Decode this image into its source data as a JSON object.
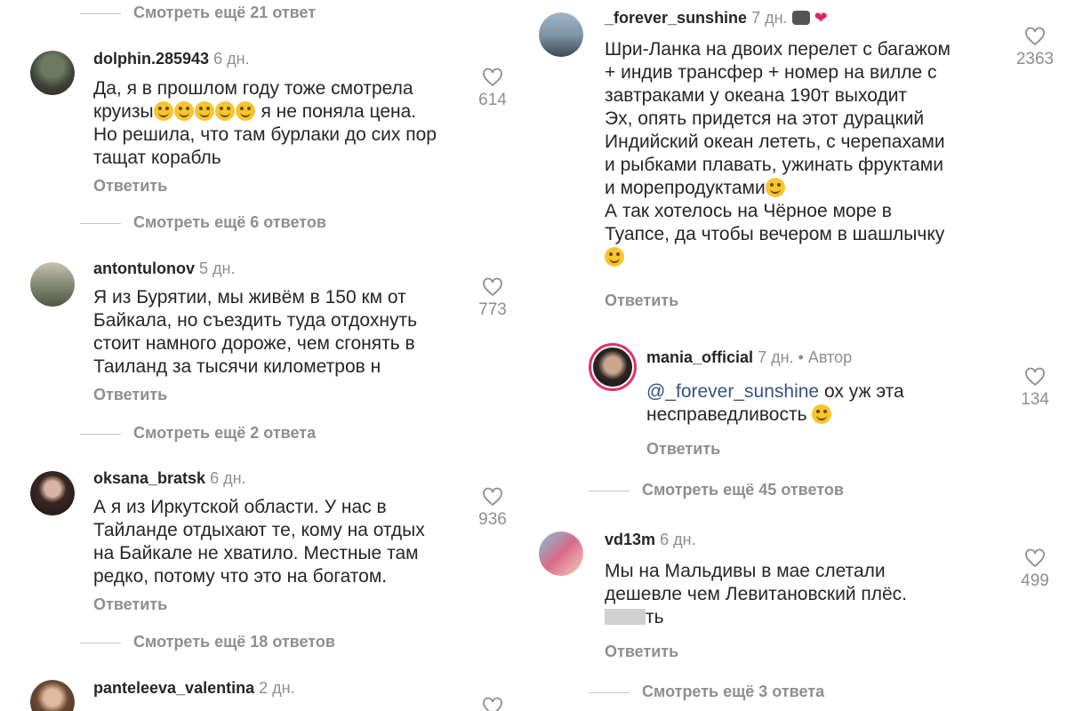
{
  "left_panel": {
    "top_more": "Смотреть ещё 21 ответ",
    "comments": [
      {
        "username": "dolphin.285943",
        "time": "6 дн.",
        "text": "Да, я в прошлом году тоже смотрела круизы",
        "text_after_emoji": "я не поняла цена.\nНо решила, что там бурлаки до сих пор\nтащат корабль",
        "likes": "614",
        "reply": "Ответить",
        "more": "Смотреть ещё 6 ответов"
      },
      {
        "username": "antontulonov",
        "time": "5 дн.",
        "text": "Я из Бурятии, мы живём в 150 км от\nБайкала,  но съездить туда отдохнуть\nстоит намного дороже,  чем сгонять в\nТаиланд за тысячи километров н",
        "likes": "773",
        "reply": "Ответить",
        "more": "Смотреть ещё 2 ответа"
      },
      {
        "username": "oksana_bratsk",
        "time": "6 дн.",
        "text": "А я из Иркутской области. У нас в\nТайланде отдыхают те, кому на отдых\nна Байкале не хватило. Местные там\nредко, потому что это на богатом.",
        "likes": "936",
        "reply": "Ответить",
        "more": "Смотреть ещё 18 ответов"
      },
      {
        "username": "panteleeva_valentina",
        "time": "2 дн."
      }
    ]
  },
  "right_panel": {
    "main_comment": {
      "username": "_forever_sunshine",
      "time": "7 дн.",
      "text": "Шри-Ланка на двоих перелет с багажом\n+ индив трансфер + номер на вилле с\nзавтраками у океана 190т выходит\nЭх, опять придется на этот дурацкий\nИндийский океан лететь, с черепахами\nи рыбками плавать, ужинать фруктами\nи морепродуктами",
      "text_tail": "А так хотелось на Чёрное море в\nТуапсе, да чтобы вечером в шашлычку",
      "likes": "2363",
      "reply": "Ответить"
    },
    "author_reply": {
      "username": "mania_official",
      "time": "7 дн.",
      "author_tag": "• Автор",
      "mention": "@_forever_sunshine",
      "text": " ох уж эта",
      "text_line2": "несправедливость",
      "likes": "134",
      "reply": "Ответить",
      "more": "Смотреть ещё 45 ответов"
    },
    "last_comment": {
      "username": "vd13m",
      "time": "6 дн.",
      "text": "Мы на Мальдивы в мае слетали\nдешевле чем Левитановский плёс.",
      "text_partial": "ть",
      "likes": "499",
      "reply": "Ответить",
      "more": "Смотреть ещё 3 ответа"
    }
  },
  "icons": {
    "like": "heart-outline-icon",
    "emoji": "smiley-emoji-icon"
  },
  "colors": {
    "text": "#262626",
    "muted": "#8e8e8e",
    "mention": "#385185",
    "ring": "#e1306c"
  }
}
